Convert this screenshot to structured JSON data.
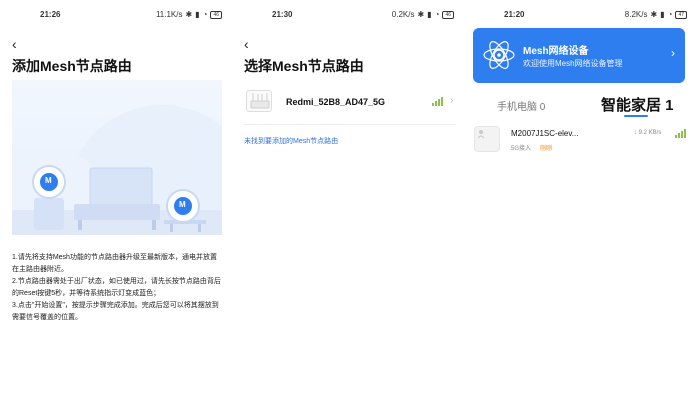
{
  "screen1": {
    "time": "21:26",
    "net_speed": "11.1K/s",
    "battery": "46",
    "title": "添加Mesh节点路由",
    "router_logo_text": "M",
    "instructions": [
      "1.请先将支持Mesh功能的节点路由器升级至最新版本，通电并放置在主路由器附近。",
      "2.节点路由器需处于出厂状态，如已使用过，请先长按节点路由背后的Reset按键5秒，并等待系统指示灯变成蓝色；",
      "3.点击\"开始设置\"，按提示步骤完成添加。完成后您可以将其摆放到需要信号覆盖的位置。"
    ]
  },
  "screen2": {
    "time": "21:30",
    "net_speed": "0.2K/s",
    "battery": "46",
    "title": "选择Mesh节点路由",
    "router_name": "Redmi_52B8_AD47_5G",
    "link_text": "未找到要添加的Mesh节点路由"
  },
  "screen3": {
    "time": "21:20",
    "net_speed": "8.2K/s",
    "battery": "47",
    "banner_title": "Mesh网络设备",
    "banner_subtitle": "欢迎使用Mesh网络设备管理",
    "tab_phone_pc": "手机电脑 0",
    "tab_smart_home": "智能家居 1",
    "device_name": "M2007J1SC-elev...",
    "device_conn": "5G接入",
    "device_tag": "刚刚",
    "device_speed": "↓ 9.2 KB/s"
  },
  "colors": {
    "accent": "#2f7ef0",
    "signal": "#8bc34a",
    "new_tag": "#f08c1a",
    "link": "#2d6fe0"
  }
}
